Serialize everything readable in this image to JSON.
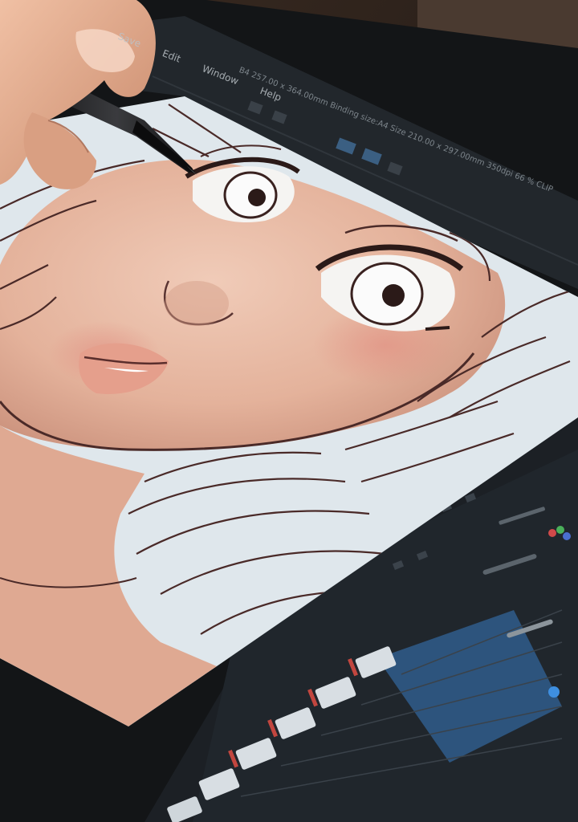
{
  "menu": {
    "items": [
      "Save",
      "Edit",
      "Window",
      "Help"
    ]
  },
  "document_info": {
    "text": "B4 257.00 x 364.00mm  Binding size:A4 Size 210.00 x 297.00mm  350dpi 66 %  CLIP"
  },
  "colors": {
    "skin": "#e7b7a0",
    "hair": "#dfe7ec",
    "lineart": "#4a2a28",
    "ui_panel": "#1d2227",
    "ui_highlight": "#3b6fa6",
    "layer_accent": "#c2463f",
    "bezel": "#121416"
  }
}
